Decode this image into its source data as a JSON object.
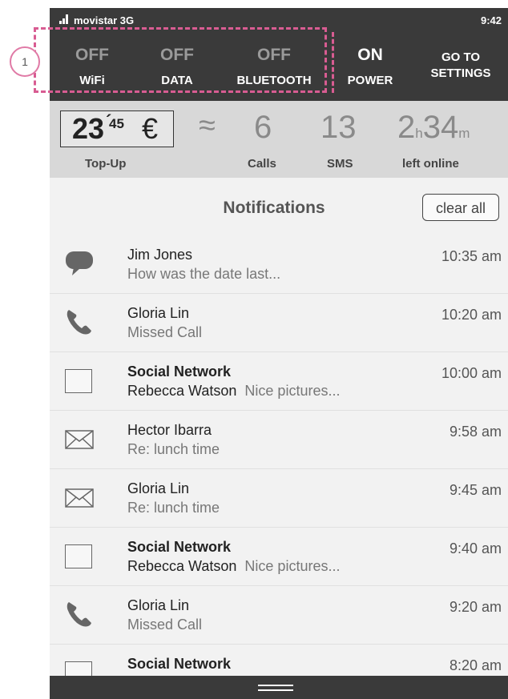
{
  "status_bar": {
    "carrier": "movistar 3G",
    "time": "9:42"
  },
  "toggles": [
    {
      "state": "OFF",
      "label": "WiFi"
    },
    {
      "state": "OFF",
      "label": "DATA"
    },
    {
      "state": "OFF",
      "label": "BLUETOOTH"
    },
    {
      "state": "ON",
      "label": "POWER"
    }
  ],
  "settings": {
    "line1": "GO TO",
    "line2": "SETTINGS"
  },
  "credit": {
    "amount_int": "23",
    "amount_dec": "45",
    "currency": "€",
    "topup_label": "Top-Up",
    "approx": "≈",
    "calls_value": "6",
    "calls_label": "Calls",
    "sms_value": "13",
    "sms_label": "SMS",
    "online_hours": "2",
    "online_h_unit": "h",
    "online_minutes": "34",
    "online_m_unit": "m",
    "online_label": "left online"
  },
  "notifications": {
    "title": "Notifications",
    "clear_label": "clear all",
    "items": [
      {
        "icon": "chat-bubble-icon",
        "title": "Jim Jones",
        "bold": false,
        "sender": "",
        "text": "How was the date last...",
        "time": "10:35 am"
      },
      {
        "icon": "phone-icon",
        "title": "Gloria Lin",
        "bold": false,
        "sender": "",
        "text": "Missed Call",
        "time": "10:20 am"
      },
      {
        "icon": "box-icon",
        "title": "Social Network",
        "bold": true,
        "sender": "Rebecca Watson",
        "text": "Nice pictures...",
        "time": "10:00 am"
      },
      {
        "icon": "envelope-icon",
        "title": "Hector Ibarra",
        "bold": false,
        "sender": "",
        "text": "Re: lunch time",
        "time": "9:58 am"
      },
      {
        "icon": "envelope-icon",
        "title": "Gloria Lin",
        "bold": false,
        "sender": "",
        "text": "Re: lunch time",
        "time": "9:45 am"
      },
      {
        "icon": "box-icon",
        "title": "Social Network",
        "bold": true,
        "sender": "Rebecca Watson",
        "text": "Nice pictures...",
        "time": "9:40 am"
      },
      {
        "icon": "phone-icon",
        "title": "Gloria Lin",
        "bold": false,
        "sender": "",
        "text": "Missed Call",
        "time": "9:20 am"
      },
      {
        "icon": "box-icon",
        "title": "Social Network",
        "bold": true,
        "sender": "",
        "text": "",
        "time": "8:20 am"
      }
    ]
  },
  "annotation": {
    "number": "1"
  },
  "colors": {
    "dark_bar": "#3a3a3a",
    "annotation": "#d85c92",
    "credit_bg": "#d8d8d8"
  }
}
